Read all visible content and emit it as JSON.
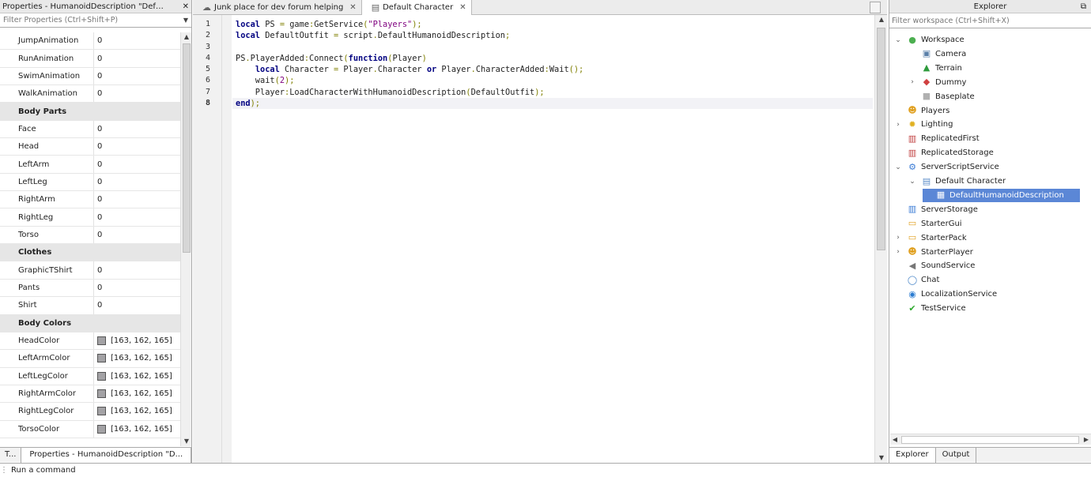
{
  "properties": {
    "title": "Properties - HumanoidDescription \"DefaultH...",
    "filter_placeholder": "Filter Properties (Ctrl+Shift+P)",
    "rows": [
      {
        "type": "prop",
        "name": "JumpAnimation",
        "value": "0"
      },
      {
        "type": "prop",
        "name": "RunAnimation",
        "value": "0"
      },
      {
        "type": "prop",
        "name": "SwimAnimation",
        "value": "0"
      },
      {
        "type": "prop",
        "name": "WalkAnimation",
        "value": "0"
      },
      {
        "type": "cat",
        "name": "Body Parts"
      },
      {
        "type": "prop",
        "name": "Face",
        "value": "0"
      },
      {
        "type": "prop",
        "name": "Head",
        "value": "0"
      },
      {
        "type": "prop",
        "name": "LeftArm",
        "value": "0"
      },
      {
        "type": "prop",
        "name": "LeftLeg",
        "value": "0"
      },
      {
        "type": "prop",
        "name": "RightArm",
        "value": "0"
      },
      {
        "type": "prop",
        "name": "RightLeg",
        "value": "0"
      },
      {
        "type": "prop",
        "name": "Torso",
        "value": "0"
      },
      {
        "type": "cat",
        "name": "Clothes"
      },
      {
        "type": "prop",
        "name": "GraphicTShirt",
        "value": "0"
      },
      {
        "type": "prop",
        "name": "Pants",
        "value": "0"
      },
      {
        "type": "prop",
        "name": "Shirt",
        "value": "0"
      },
      {
        "type": "cat",
        "name": "Body Colors"
      },
      {
        "type": "color",
        "name": "HeadColor",
        "value": "[163, 162, 165]",
        "color": "#a3a2a5"
      },
      {
        "type": "color",
        "name": "LeftArmColor",
        "value": "[163, 162, 165]",
        "color": "#a3a2a5"
      },
      {
        "type": "color",
        "name": "LeftLegColor",
        "value": "[163, 162, 165]",
        "color": "#a3a2a5"
      },
      {
        "type": "color",
        "name": "RightArmColor",
        "value": "[163, 162, 165]",
        "color": "#a3a2a5"
      },
      {
        "type": "color",
        "name": "RightLegColor",
        "value": "[163, 162, 165]",
        "color": "#a3a2a5"
      },
      {
        "type": "color",
        "name": "TorsoColor",
        "value": "[163, 162, 165]",
        "color": "#a3a2a5"
      }
    ],
    "tabs": [
      {
        "label": "T...",
        "active": false
      },
      {
        "label": "Properties - HumanoidDescription \"D...",
        "active": true
      }
    ]
  },
  "editor": {
    "tabs": [
      {
        "label": "Junk place for dev forum helping",
        "icon": "cloud-icon",
        "active": false
      },
      {
        "label": "Default Character",
        "icon": "script-icon",
        "active": true
      }
    ],
    "current_line": 8,
    "lines": [
      [
        {
          "t": "kw",
          "v": "local"
        },
        {
          "t": "n",
          "v": " PS "
        },
        {
          "t": "op",
          "v": "="
        },
        {
          "t": "n",
          "v": " game"
        },
        {
          "t": "op",
          "v": ":"
        },
        {
          "t": "n",
          "v": "GetService"
        },
        {
          "t": "op",
          "v": "("
        },
        {
          "t": "str",
          "v": "\"Players\""
        },
        {
          "t": "op",
          "v": ");"
        }
      ],
      [
        {
          "t": "kw",
          "v": "local"
        },
        {
          "t": "n",
          "v": " DefaultOutfit "
        },
        {
          "t": "op",
          "v": "="
        },
        {
          "t": "n",
          "v": " script"
        },
        {
          "t": "op",
          "v": "."
        },
        {
          "t": "n",
          "v": "DefaultHumanoidDescription"
        },
        {
          "t": "op",
          "v": ";"
        }
      ],
      [],
      [
        {
          "t": "n",
          "v": "PS"
        },
        {
          "t": "op",
          "v": "."
        },
        {
          "t": "n",
          "v": "PlayerAdded"
        },
        {
          "t": "op",
          "v": ":"
        },
        {
          "t": "n",
          "v": "Connect"
        },
        {
          "t": "op",
          "v": "("
        },
        {
          "t": "kw",
          "v": "function"
        },
        {
          "t": "op",
          "v": "("
        },
        {
          "t": "n",
          "v": "Player"
        },
        {
          "t": "op",
          "v": ")"
        }
      ],
      [
        {
          "t": "n",
          "v": "    "
        },
        {
          "t": "kw",
          "v": "local"
        },
        {
          "t": "n",
          "v": " Character "
        },
        {
          "t": "op",
          "v": "="
        },
        {
          "t": "n",
          "v": " Player"
        },
        {
          "t": "op",
          "v": "."
        },
        {
          "t": "n",
          "v": "Character "
        },
        {
          "t": "kw",
          "v": "or"
        },
        {
          "t": "n",
          "v": " Player"
        },
        {
          "t": "op",
          "v": "."
        },
        {
          "t": "n",
          "v": "CharacterAdded"
        },
        {
          "t": "op",
          "v": ":"
        },
        {
          "t": "n",
          "v": "Wait"
        },
        {
          "t": "op",
          "v": "();"
        }
      ],
      [
        {
          "t": "n",
          "v": "    wait"
        },
        {
          "t": "op",
          "v": "("
        },
        {
          "t": "str",
          "v": "2"
        },
        {
          "t": "op",
          "v": ");"
        }
      ],
      [
        {
          "t": "n",
          "v": "    Player"
        },
        {
          "t": "op",
          "v": ":"
        },
        {
          "t": "n",
          "v": "LoadCharacterWithHumanoidDescription"
        },
        {
          "t": "op",
          "v": "("
        },
        {
          "t": "n",
          "v": "DefaultOutfit"
        },
        {
          "t": "op",
          "v": ");"
        }
      ],
      [
        {
          "t": "kw",
          "v": "end"
        },
        {
          "t": "op",
          "v": ");"
        }
      ]
    ]
  },
  "explorer": {
    "title": "Explorer",
    "filter_placeholder": "Filter workspace (Ctrl+Shift+X)",
    "nodes": [
      {
        "label": "Workspace",
        "depth": 0,
        "chevron": "down",
        "icon": "workspace-icon"
      },
      {
        "label": "Camera",
        "depth": 1,
        "chevron": "",
        "icon": "camera-icon"
      },
      {
        "label": "Terrain",
        "depth": 1,
        "chevron": "",
        "icon": "terrain-icon"
      },
      {
        "label": "Dummy",
        "depth": 1,
        "chevron": "right",
        "icon": "model-icon"
      },
      {
        "label": "Baseplate",
        "depth": 1,
        "chevron": "",
        "icon": "part-icon"
      },
      {
        "label": "Players",
        "depth": 0,
        "chevron": "",
        "icon": "players-icon"
      },
      {
        "label": "Lighting",
        "depth": 0,
        "chevron": "right",
        "icon": "lighting-icon"
      },
      {
        "label": "ReplicatedFirst",
        "depth": 0,
        "chevron": "",
        "icon": "replicated-first-icon"
      },
      {
        "label": "ReplicatedStorage",
        "depth": 0,
        "chevron": "",
        "icon": "replicated-storage-icon"
      },
      {
        "label": "ServerScriptService",
        "depth": 0,
        "chevron": "down",
        "icon": "server-script-service-icon"
      },
      {
        "label": "Default Character",
        "depth": 1,
        "chevron": "down",
        "icon": "script-icon"
      },
      {
        "label": "DefaultHumanoidDescription",
        "depth": 2,
        "chevron": "",
        "icon": "humanoid-description-icon",
        "selected": true
      },
      {
        "label": "ServerStorage",
        "depth": 0,
        "chevron": "",
        "icon": "server-storage-icon"
      },
      {
        "label": "StarterGui",
        "depth": 0,
        "chevron": "",
        "icon": "starter-gui-icon"
      },
      {
        "label": "StarterPack",
        "depth": 0,
        "chevron": "right",
        "icon": "starter-pack-icon"
      },
      {
        "label": "StarterPlayer",
        "depth": 0,
        "chevron": "right",
        "icon": "starter-player-icon"
      },
      {
        "label": "SoundService",
        "depth": 0,
        "chevron": "",
        "icon": "sound-service-icon"
      },
      {
        "label": "Chat",
        "depth": 0,
        "chevron": "",
        "icon": "chat-icon"
      },
      {
        "label": "LocalizationService",
        "depth": 0,
        "chevron": "",
        "icon": "localization-icon"
      },
      {
        "label": "TestService",
        "depth": 0,
        "chevron": "",
        "icon": "test-service-icon"
      }
    ],
    "tabs": [
      {
        "label": "Explorer",
        "active": true
      },
      {
        "label": "Output",
        "active": false
      }
    ]
  },
  "command_bar": {
    "placeholder": "Run a command"
  },
  "colors": {
    "keyword": "#000080",
    "string": "#7f007f",
    "operator": "#7f7f00",
    "selection": "#5b87d6",
    "category_bg": "#e6e6e6"
  }
}
